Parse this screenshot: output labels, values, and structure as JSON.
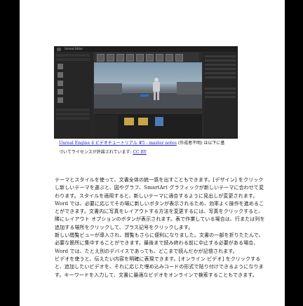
{
  "figure": {
    "editor_title": "Unreal Editor",
    "caption_link": "Unreal Engine 4 ビデオチュートリアル #5 - master notes",
    "caption_mid": " (作成者不明) は以下に基づいてライセンスが許諾されています: ",
    "license_link": "CC BY"
  },
  "paragraphs": [
    "テーマとスタイルを使って、文書全体の統一感を出すこともできます。[デザイン] をクリックし新しいテーマを選ぶと、図やグラフ、SmartArt グラフィックが新しいテーマに合わせて変わります。スタイルを適用すると、新しいテーマに適合するように見出しが変更されます。",
    "Word では、必要に応じてその場に新しいボタンが表示されるため、効率よく操作を進めることができます。文書内に写真をレイアウトする方法を変更するには、写真をクリックすると、隣にレイアウト オプションのボタンが表示されます。表で作業している場合は、行または列を追加する場所をクリックして、プラス記号をクリックします。",
    "新しい閲覧ビューが導入され、閲覧もさらに便利になりました。文書の一部を折りたたんで、必要な箇所に集中することができます。最後まで読み終わる前に中止する必要がある場合、Word では、たとえ別のデバイスであっても、どこまで読んだかが記憶されます。",
    "ビデオを使うと、伝えたい内容を明確に表現できます。[オンライン ビデオ] をクリックすると、追加したいビデオを、それに応じた埋め込みコードの形式で貼り付けできるようになります。キーワードを入力して、文書に最適なビデオをオンラインで検索することもできます。"
  ]
}
